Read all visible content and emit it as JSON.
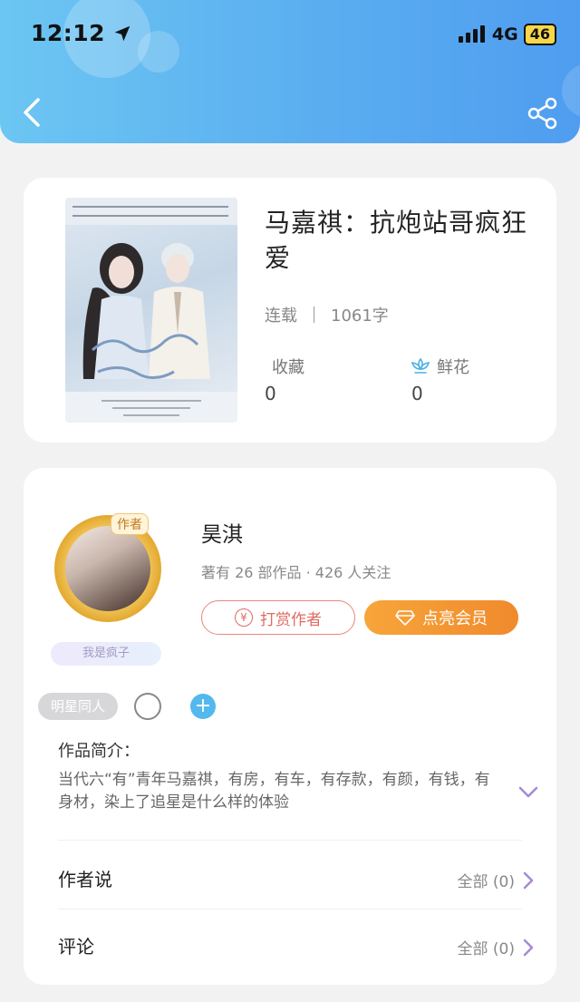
{
  "status_bar": {
    "time": "12:12",
    "network": "4G",
    "battery": "46",
    "location_icon": "location-arrow-icon"
  },
  "header": {
    "back_icon": "chevron-left-icon",
    "share_icon": "share-icon",
    "gradient_colors": [
      "#6cc6f2",
      "#4f9df0"
    ]
  },
  "book": {
    "title": "马嘉祺：抗炮站哥疯狂爱",
    "status": "连载",
    "word_count": "1061字",
    "favorites_label": "收藏",
    "favorites_count": "0",
    "flowers_label": "鲜花",
    "flowers_count": "0",
    "cover_text": "你是我唯一的心动 · 抗炮站哥疯狂爱"
  },
  "author": {
    "badge": "作者",
    "name": "昊淇",
    "stats": "著有 26 部作品 · 426 人关注",
    "persona_tag": "我是疯子",
    "tip_button": "打赏作者",
    "vip_button": "点亮会员",
    "accent_colors": {
      "tip": "#e06a62",
      "vip": "#f08a2c"
    }
  },
  "tags": {
    "category": "明星同人"
  },
  "intro": {
    "label": "作品简介：",
    "text": "当代六“有”青年马嘉祺，有房，有车，有存款，有颜，有钱，有身材，染上了追星是什么样的体验"
  },
  "rows": [
    {
      "title": "作者说",
      "value": "全部 (0)"
    },
    {
      "title": "评论",
      "value": "全部 (0)"
    }
  ]
}
